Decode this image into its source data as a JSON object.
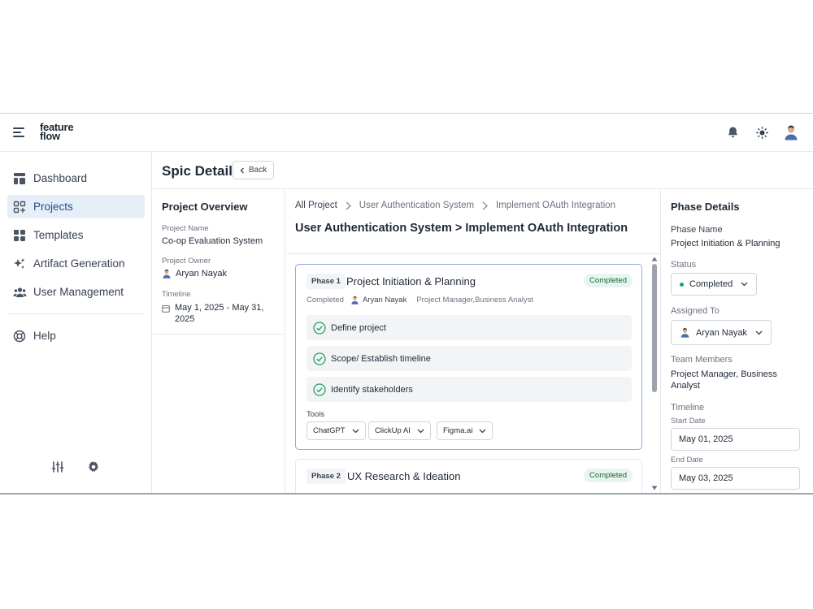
{
  "app": {
    "logo_line1": "feature",
    "logo_line2": "flow"
  },
  "sidebar": {
    "items": [
      {
        "label": "Dashboard"
      },
      {
        "label": "Projects"
      },
      {
        "label": "Templates"
      },
      {
        "label": "Artifact Generation"
      },
      {
        "label": "User Management"
      },
      {
        "label": "Help"
      }
    ],
    "active": "Projects"
  },
  "header": {
    "title": "Spic Detail",
    "back_label": "Back"
  },
  "overview": {
    "title": "Project Overview",
    "name_label": "Project Name",
    "name_value": "Co-op Evaluation System",
    "owner_label": "Project Owner",
    "owner_value": "Aryan Nayak",
    "timeline_label": "Timeline",
    "timeline_value": "May 1, 2025 - May 31, 2025"
  },
  "breadcrumb": [
    "All Project",
    "User Authentication System",
    "Implement OAuth Integration"
  ],
  "center_title": "User Authentication System > Implement OAuth Integration",
  "phases": [
    {
      "badge": "Phase 1",
      "name": "Project Initiation & Planning",
      "status": "Completed",
      "meta_status": "Completed",
      "owner": "Aryan Nayak",
      "roles": "Project Manager,Business Analyst",
      "tasks": [
        "Define project",
        "Scope/ Establish timeline",
        "Identify stakeholders"
      ],
      "tools_label": "Tools",
      "tools": [
        "ChatGPT",
        "ClickUp AI",
        "Figma.ai"
      ]
    },
    {
      "badge": "Phase 2",
      "name": "UX Research & Ideation",
      "status": "Completed"
    }
  ],
  "phase_details": {
    "title": "Phase Details",
    "phase_name_label": "Phase Name",
    "phase_name_value": "Project Initiation & Planning",
    "status_label": "Status",
    "status_value": "Completed",
    "assigned_label": "Assigned To",
    "assigned_value": "Aryan Nayak",
    "team_label": "Team Members",
    "team_value": "Project Manager, Business Analyst",
    "timeline_label": "Timeline",
    "start_label": "Start Date",
    "start_value": "May 01, 2025",
    "end_label": "End Date",
    "end_value": "May 03, 2025"
  },
  "colors": {
    "accent": "#1e4e8c",
    "active_bg": "#e6eef8",
    "success": "#22a06b",
    "success_bg": "#e8f5ee"
  }
}
